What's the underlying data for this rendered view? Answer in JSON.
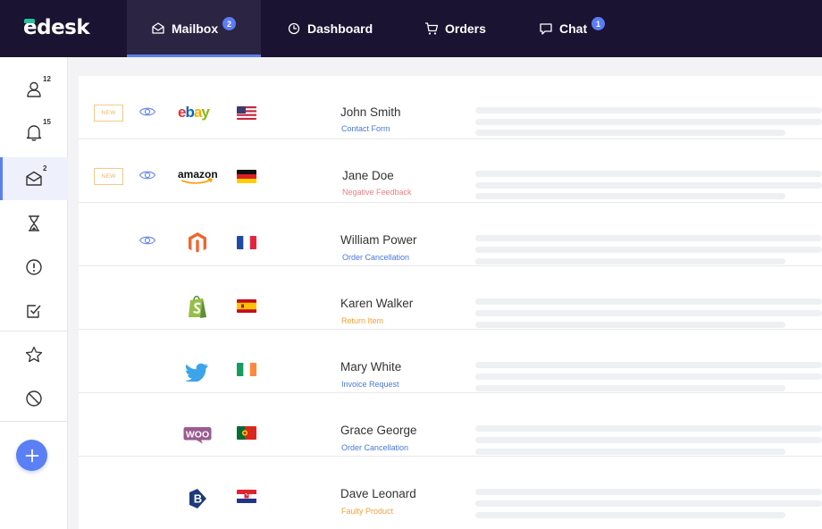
{
  "app": {
    "logo": "edesk"
  },
  "nav": {
    "tabs": [
      {
        "label": "Mailbox",
        "icon": "envelope-icon",
        "badge": "2",
        "active": true
      },
      {
        "label": "Dashboard",
        "icon": "clock-icon",
        "badge": null,
        "active": false
      },
      {
        "label": "Orders",
        "icon": "cart-icon",
        "badge": null,
        "active": false
      },
      {
        "label": "Chat",
        "icon": "chat-icon",
        "badge": "1",
        "active": false
      }
    ]
  },
  "sidebar": {
    "items": [
      {
        "icon": "user-icon",
        "count": "12"
      },
      {
        "icon": "bell-icon",
        "count": "15"
      },
      {
        "icon": "envelope-icon",
        "count": "2",
        "active": true
      },
      {
        "icon": "hourglass-icon",
        "count": ""
      },
      {
        "icon": "alert-icon",
        "count": ""
      },
      {
        "icon": "check-square-icon",
        "count": ""
      },
      {
        "icon": "star-icon",
        "count": ""
      },
      {
        "icon": "block-icon",
        "count": ""
      }
    ],
    "add_icon": "plus-icon"
  },
  "colors": {
    "accent": "#5b7ff5",
    "topbar": "#1a1331",
    "status_blue": "#4a78d6",
    "status_red": "#ee7f84",
    "status_orange": "#f2a23b"
  },
  "messages": [
    {
      "new": true,
      "new_label": "NEW",
      "viewed": true,
      "channel": "ebay",
      "flag": "us",
      "name": "John Smith",
      "subject": "Contact Form",
      "subject_color": "#4a78d6"
    },
    {
      "new": true,
      "new_label": "NEW",
      "viewed": true,
      "channel": "amazon",
      "flag": "de",
      "name": "Jane Doe",
      "subject": "Negative Feedback",
      "subject_color": "#ee7f84"
    },
    {
      "new": false,
      "viewed": true,
      "channel": "magento",
      "flag": "fr",
      "name": "William Power",
      "subject": "Order Cancellation",
      "subject_color": "#4a78d6"
    },
    {
      "new": false,
      "viewed": false,
      "channel": "shopify",
      "flag": "es",
      "name": "Karen Walker",
      "subject": "Return Item",
      "subject_color": "#f2a23b"
    },
    {
      "new": false,
      "viewed": false,
      "channel": "twitter",
      "flag": "ie",
      "name": "Mary White",
      "subject": "Invoice Request",
      "subject_color": "#4a78d6"
    },
    {
      "new": false,
      "viewed": false,
      "channel": "woo",
      "channel_text": "WOO",
      "flag": "pt",
      "name": "Grace George",
      "subject": "Order Cancellation",
      "subject_color": "#4a78d6"
    },
    {
      "new": false,
      "viewed": false,
      "channel": "bigcommerce",
      "flag": "hr",
      "name": "Dave Leonard",
      "subject": "Faulty Product",
      "subject_color": "#f2a23b"
    }
  ]
}
